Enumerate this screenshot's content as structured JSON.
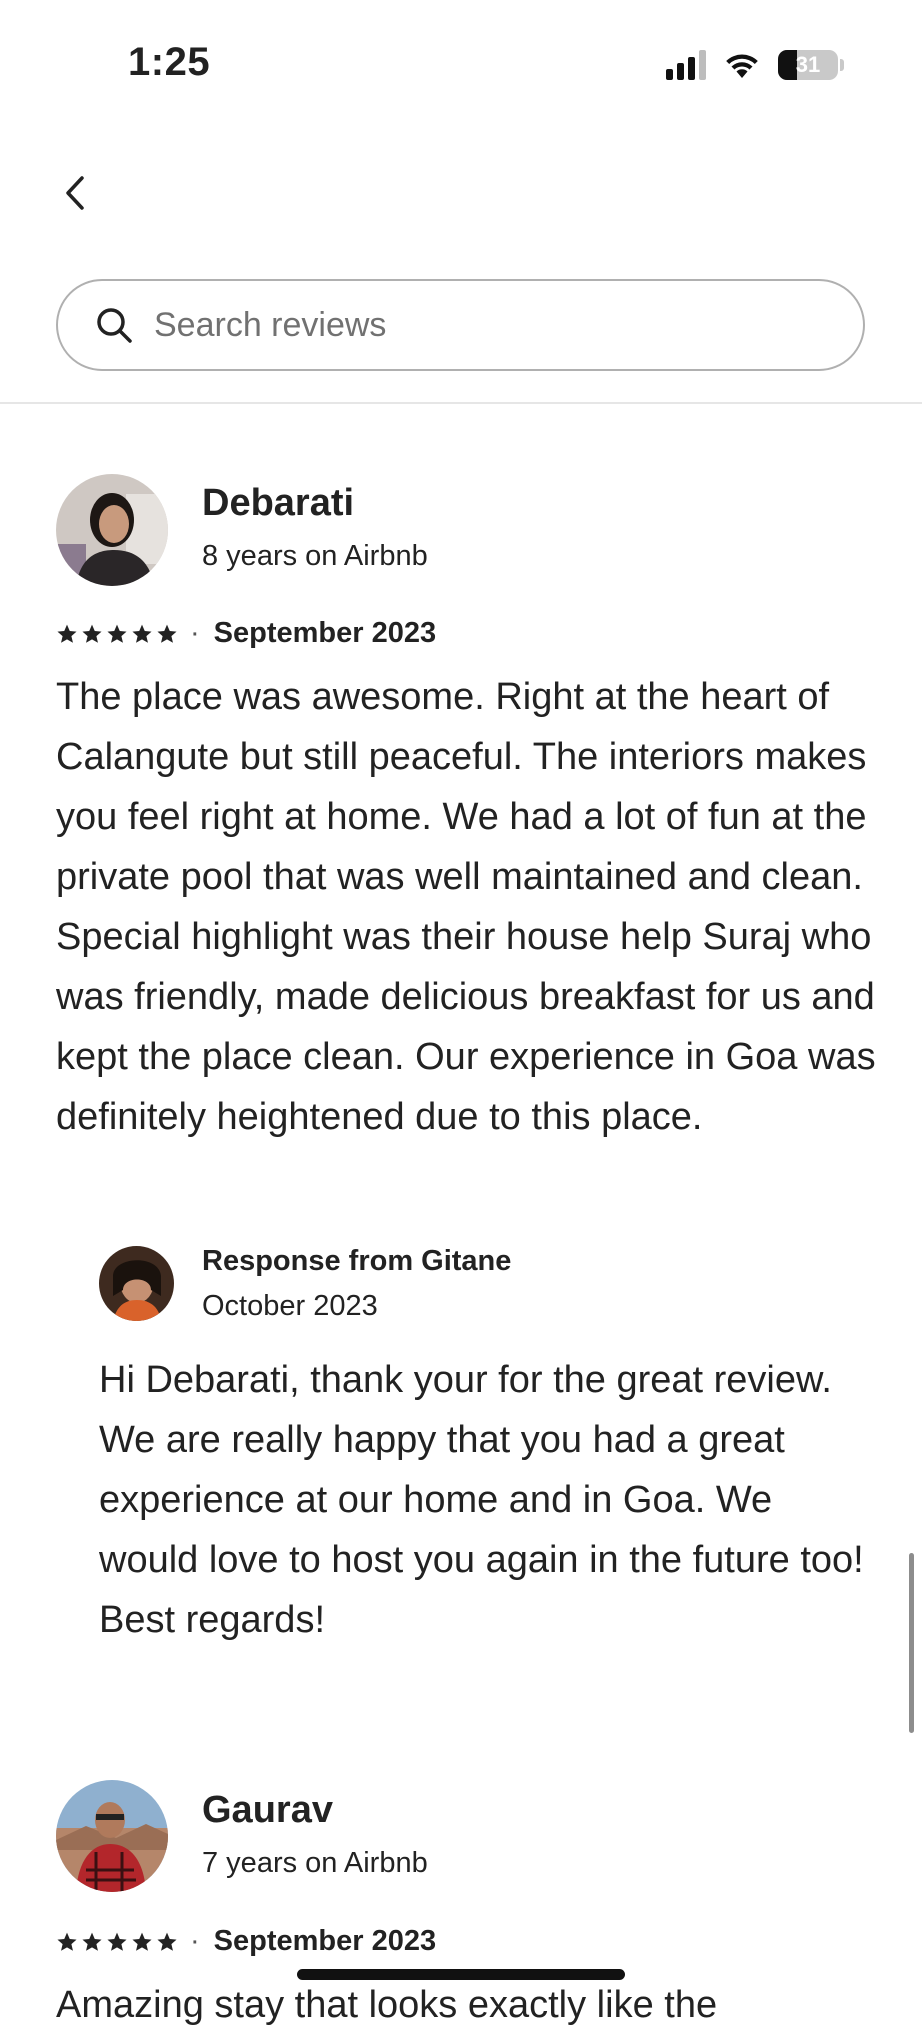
{
  "status_bar": {
    "time": "1:25",
    "battery": "31",
    "battery_level": 0.31
  },
  "search": {
    "placeholder": "Search reviews"
  },
  "reviews": [
    {
      "name": "Debarati",
      "tenure": "8 years on Airbnb",
      "rating": 5,
      "date": "September 2023",
      "separator": "·",
      "text": "The place was awesome. Right at the heart of Calangute but still peaceful. The interiors makes you feel right at home. We had a lot of fun at the private pool that was well maintained and clean. Special highlight was their house help Suraj who was friendly, made delicious breakfast for us and kept the place clean. Our experience in Goa was definitely heightened due to this place.",
      "response": {
        "title": "Response from Gitane",
        "date": "October 2023",
        "text": "Hi Debarati, thank your for the great review. We are really happy that you had a great experience at our home and in Goa. We would love to host you again in the future too!\nBest regards!"
      }
    },
    {
      "name": "Gaurav",
      "tenure": "7 years on Airbnb",
      "rating": 5,
      "date": "September 2023",
      "separator": "·",
      "text_partial": "Amazing stay that looks exactly like the"
    }
  ],
  "icons": {
    "back": "chevron-left-icon",
    "search": "search-icon",
    "star": "star-icon"
  },
  "colors": {
    "text": "#222222",
    "muted": "#717171",
    "border": "#b0b0b0",
    "divider": "#e6e6e6"
  }
}
